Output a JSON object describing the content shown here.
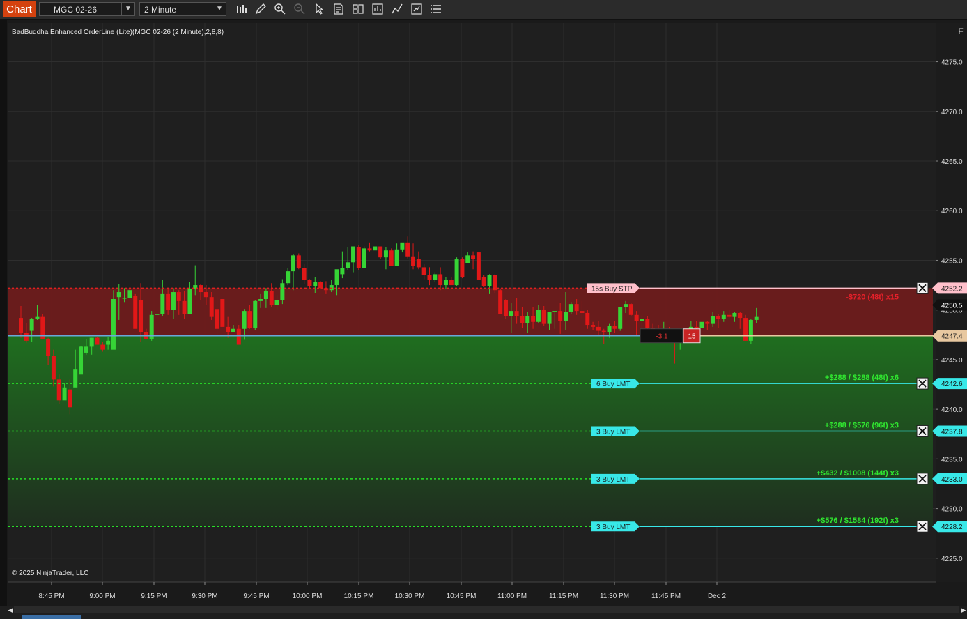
{
  "toolbar": {
    "chart_tab": "Chart",
    "instrument": "MGC 02-26",
    "interval": "2 Minute",
    "tools": [
      "bars-icon",
      "pencil-icon",
      "zoom-in-icon",
      "zoom-out-icon",
      "cursor-icon",
      "data-box-icon",
      "properties-icon",
      "indicators-icon",
      "strategies-icon",
      "snapshot-icon",
      "menu-icon"
    ]
  },
  "indicator_label": "BadBuddha Enhanced OrderLine (Lite)(MGC 02-26 (2 Minute),2,8,8)",
  "copyright": "© 2025 NinjaTrader, LLC",
  "f_button": "F",
  "colors": {
    "background": "#1e1e1e",
    "up_candle": "#36d436",
    "down_candle": "#e01818",
    "stop_zone": "#6e1c1c",
    "profit_zone": "#1f6b1f",
    "cyan": "#38e8e8",
    "pink": "#ffc0cb",
    "entry_line": "#69a8d8"
  },
  "chart_data": {
    "type": "candlestick",
    "instrument": "MGC 02-26",
    "interval": "2 Minute",
    "ylim": [
      4222.6,
      4278.9
    ],
    "y_ticks": [
      "4225.0",
      "4230.0",
      "4235.0",
      "4240.0",
      "4245.0",
      "4250.0",
      "4255.0",
      "4260.0",
      "4265.0",
      "4270.0",
      "4275.0"
    ],
    "x_ticks": [
      "8:45 PM",
      "9:00 PM",
      "9:15 PM",
      "9:30 PM",
      "9:45 PM",
      "10:00 PM",
      "10:15 PM",
      "10:30 PM",
      "10:45 PM",
      "11:00 PM",
      "11:15 PM",
      "11:30 PM",
      "11:45 PM",
      "Dec 2"
    ],
    "bar_count": 136,
    "candles": [
      [
        4249.2,
        4250.4,
        4247.2,
        4247.7
      ],
      [
        4247.7,
        4248.7,
        4246.7,
        4246.9
      ],
      [
        4247.9,
        4249.2,
        4246.8,
        4249.1
      ],
      [
        4249.1,
        4250.5,
        4249.0,
        4249.3
      ],
      [
        4249.3,
        4249.6,
        4247.3,
        4247.1
      ],
      [
        4247.1,
        4247.2,
        4244.5,
        4245.4
      ],
      [
        4245.4,
        4246.0,
        4242.3,
        4243.0
      ],
      [
        4243.0,
        4243.5,
        4240.5,
        4240.9
      ],
      [
        4240.9,
        4242.6,
        4241.8,
        4242.2
      ],
      [
        4242.0,
        4243.0,
        4239.5,
        4240.2
      ],
      [
        4242.2,
        4246.0,
        4243.4,
        4244.0
      ],
      [
        4243.5,
        4246.4,
        4243.6,
        4246.3
      ],
      [
        4245.7,
        4247.1,
        4245.5,
        4246.3
      ],
      [
        4246.3,
        4247.2,
        4245.5,
        4247.2
      ],
      [
        4247.2,
        4247.3,
        4246.5,
        4246.5
      ],
      [
        4246.5,
        4246.8,
        4245.8,
        4246.0
      ],
      [
        4246.5,
        4247.3,
        4246.0,
        4246.9
      ],
      [
        4246.0,
        4252.0,
        4247.0,
        4251.1
      ],
      [
        4251.3,
        4252.6,
        4249.0,
        4251.8
      ],
      [
        4251.2,
        4252.2,
        4250.8,
        4251.2
      ],
      [
        4251.2,
        4252.2,
        4251.5,
        4252.0
      ],
      [
        4251.4,
        4251.6,
        4249.2,
        4248.1
      ],
      [
        4251.0,
        4252.7,
        4246.8,
        4247.8
      ],
      [
        4247.8,
        4248.1,
        4247.2,
        4247.1
      ],
      [
        4247.1,
        4249.9,
        4246.9,
        4249.5
      ],
      [
        4249.5,
        4250.1,
        4248.6,
        4249.6
      ],
      [
        4249.6,
        4253.0,
        4249.4,
        4251.6
      ],
      [
        4251.6,
        4252.2,
        4249.5,
        4250.0
      ],
      [
        4250.0,
        4252.2,
        4249.1,
        4251.8
      ],
      [
        4251.8,
        4252.0,
        4249.5,
        4250.9
      ],
      [
        4250.9,
        4251.9,
        4249.1,
        4249.6
      ],
      [
        4249.6,
        4252.8,
        4250.8,
        4252.1
      ],
      [
        4252.1,
        4254.5,
        4251.5,
        4252.5
      ],
      [
        4252.5,
        4252.6,
        4251.0,
        4251.8
      ],
      [
        4251.8,
        4252.5,
        4250.5,
        4251.3
      ],
      [
        4251.3,
        4251.8,
        4249.0,
        4249.3
      ],
      [
        4250.1,
        4251.4,
        4247.3,
        4248.1
      ],
      [
        4251.1,
        4251.1,
        4248.4,
        4248.3
      ],
      [
        4248.3,
        4249.3,
        4247.2,
        4247.8
      ],
      [
        4247.8,
        4248.5,
        4247.8,
        4248.1
      ],
      [
        4248.1,
        4248.5,
        4246.8,
        4246.5
      ],
      [
        4248.1,
        4250.1,
        4247.0,
        4249.9
      ],
      [
        4249.9,
        4250.5,
        4248.1,
        4248.2
      ],
      [
        4248.2,
        4251.0,
        4248.0,
        4250.9
      ],
      [
        4250.9,
        4251.6,
        4250.2,
        4251.1
      ],
      [
        4251.1,
        4252.2,
        4250.2,
        4251.9
      ],
      [
        4251.9,
        4252.7,
        4250.3,
        4250.5
      ],
      [
        4250.5,
        4251.5,
        4250.1,
        4251.0
      ],
      [
        4251.0,
        4253.1,
        4250.6,
        4252.7
      ],
      [
        4252.7,
        4254.2,
        4252.5,
        4253.9
      ],
      [
        4253.9,
        4255.6,
        4252.0,
        4255.5
      ],
      [
        4255.5,
        4255.7,
        4254.1,
        4254.2
      ],
      [
        4254.2,
        4254.6,
        4252.6,
        4253.0
      ],
      [
        4253.0,
        4253.1,
        4252.1,
        4252.4
      ],
      [
        4252.4,
        4253.3,
        4251.7,
        4252.8
      ],
      [
        4252.8,
        4252.9,
        4252.1,
        4252.2
      ],
      [
        4252.2,
        4252.9,
        4251.6,
        4252.0
      ],
      [
        4252.0,
        4253.0,
        4251.8,
        4252.5
      ],
      [
        4252.5,
        4253.0,
        4251.5,
        4254.1
      ],
      [
        4253.6,
        4255.9,
        4253.2,
        4254.2
      ],
      [
        4254.2,
        4256.3,
        4254.0,
        4254.8
      ],
      [
        4254.8,
        4256.3,
        4253.8,
        4256.4
      ],
      [
        4256.3,
        4256.5,
        4254.0,
        4254.2
      ],
      [
        4254.2,
        4256.4,
        4254.2,
        4256.2
      ],
      [
        4256.2,
        4256.8,
        4255.9,
        4256.0
      ],
      [
        4256.0,
        4256.3,
        4256.2,
        4256.4
      ],
      [
        4256.4,
        4256.4,
        4255.1,
        4255.3
      ],
      [
        4255.3,
        4256.3,
        4254.1,
        4256.0
      ],
      [
        4256.0,
        4256.2,
        4254.4,
        4254.4
      ],
      [
        4254.4,
        4256.7,
        4255.3,
        4256.1
      ],
      [
        4256.1,
        4256.4,
        4255.8,
        4256.8
      ],
      [
        4256.8,
        4257.4,
        4255.2,
        4255.4
      ],
      [
        4255.4,
        4256.7,
        4254.1,
        4254.4
      ],
      [
        4255.1,
        4255.9,
        4254.1,
        4254.3
      ],
      [
        4254.3,
        4254.6,
        4253.1,
        4253.5
      ],
      [
        4253.5,
        4254.3,
        4252.5,
        4253.0
      ],
      [
        4253.0,
        4253.8,
        4252.8,
        4253.6
      ],
      [
        4253.6,
        4254.3,
        4252.0,
        4252.5
      ],
      [
        4252.5,
        4253.3,
        4252.1,
        4253.0
      ],
      [
        4253.0,
        4253.3,
        4252.5,
        4252.5
      ],
      [
        4252.5,
        4255.3,
        4252.4,
        4255.1
      ],
      [
        4255.1,
        4255.3,
        4253.2,
        4253.3
      ],
      [
        4254.7,
        4255.8,
        4255.0,
        4255.5
      ],
      [
        4255.5,
        4255.9,
        4254.1,
        4255.1
      ],
      [
        4255.8,
        4255.3,
        4253.8,
        4253.0
      ],
      [
        4253.3,
        4253.5,
        4252.3,
        4252.4
      ],
      [
        4252.4,
        4253.6,
        4251.6,
        4253.5
      ],
      [
        4253.5,
        4253.6,
        4251.7,
        4252.0
      ],
      [
        4252.0,
        4252.1,
        4249.8,
        4249.6
      ],
      [
        4251.0,
        4251.1,
        4249.1,
        4249.4
      ],
      [
        4249.4,
        4250.7,
        4247.7,
        4249.9
      ],
      [
        4249.9,
        4251.2,
        4248.6,
        4249.4
      ],
      [
        4249.4,
        4250.3,
        4248.2,
        4248.7
      ],
      [
        4248.7,
        4249.8,
        4247.7,
        4249.4
      ],
      [
        4249.4,
        4250.3,
        4248.1,
        4248.8
      ],
      [
        4248.8,
        4250.5,
        4248.7,
        4250.0
      ],
      [
        4250.0,
        4250.4,
        4248.4,
        4248.6
      ],
      [
        4248.6,
        4249.8,
        4248.0,
        4249.8
      ],
      [
        4249.8,
        4249.8,
        4248.1,
        4249.9
      ],
      [
        4249.9,
        4250.7,
        4247.6,
        4248.9
      ],
      [
        4248.9,
        4251.8,
        4248.0,
        4249.8
      ],
      [
        4249.8,
        4250.8,
        4249.6,
        4250.6
      ],
      [
        4250.6,
        4251.1,
        4249.5,
        4249.9
      ],
      [
        4249.9,
        4250.9,
        4249.1,
        4249.7
      ],
      [
        4249.7,
        4250.0,
        4248.1,
        4248.5
      ],
      [
        4248.5,
        4248.8,
        4248.0,
        4248.3
      ],
      [
        4248.3,
        4248.9,
        4247.4,
        4247.9
      ],
      [
        4247.9,
        4248.1,
        4246.6,
        4247.8
      ],
      [
        4247.8,
        4248.6,
        4247.2,
        4248.4
      ],
      [
        4248.4,
        4248.9,
        4247.7,
        4248.1
      ],
      [
        4248.1,
        4250.2,
        4247.9,
        4250.3
      ],
      [
        4250.3,
        4250.9,
        4249.7,
        4250.6
      ],
      [
        4250.6,
        4250.7,
        4249.4,
        4249.5
      ],
      [
        4249.5,
        4249.9,
        4247.5,
        4248.9
      ],
      [
        4248.9,
        4249.5,
        4247.9,
        4249.1
      ],
      [
        4249.1,
        4249.4,
        4247.8,
        4248.2
      ],
      [
        4248.2,
        4248.6,
        4247.5,
        4248.0
      ],
      [
        4248.0,
        4248.5,
        4247.6,
        4247.7
      ],
      [
        4247.7,
        4248.8,
        4247.4,
        4247.8
      ],
      [
        4247.8,
        4248.3,
        4247.2,
        4247.3
      ],
      [
        4247.3,
        4247.5,
        4244.6,
        4246.8
      ],
      [
        4246.8,
        4247.7,
        4246.0,
        4247.4
      ],
      [
        4247.4,
        4248.1,
        4246.9,
        4247.8
      ],
      [
        4247.8,
        4248.9,
        4247.1,
        4248.3
      ],
      [
        4248.3,
        4248.9,
        4247.8,
        4248.2
      ],
      [
        4248.2,
        4249.0,
        4248.1,
        4248.8
      ],
      [
        4248.8,
        4248.9,
        4248.0,
        4248.6
      ],
      [
        4248.6,
        4249.8,
        4248.3,
        4249.4
      ],
      [
        4249.4,
        4249.6,
        4248.2,
        4249.1
      ],
      [
        4249.1,
        4249.9,
        4248.8,
        4249.5
      ],
      [
        4249.5,
        4250.0,
        4249.2,
        4249.3
      ],
      [
        4249.3,
        4249.8,
        4248.8,
        4249.7
      ],
      [
        4249.7,
        4249.8,
        4248.1,
        4249.2
      ],
      [
        4249.2,
        4249.5,
        4246.9,
        4246.9
      ],
      [
        4246.9,
        4249.1,
        4246.6,
        4249.0
      ],
      [
        4249.0,
        4250.2,
        4248.7,
        4249.3
      ]
    ]
  },
  "price_axis": {
    "stop_price": "4252.2",
    "last_price": "4250.5",
    "entry_price": "4247.4",
    "target_prices": [
      "4242.6",
      "4237.8",
      "4233.0",
      "4228.2"
    ]
  },
  "orders": {
    "stop": {
      "label": "15s  Buy STP",
      "price": 4252.2,
      "pnl": "-$720 (48t) x15"
    },
    "entry": {
      "price": 4247.4,
      "pnl_box": "-3.1",
      "qty_box": "15"
    },
    "targets": [
      {
        "label": "6  Buy LMT",
        "price": 4242.6,
        "pnl": "+$288 / $288 (48t) x6"
      },
      {
        "label": "3  Buy LMT",
        "price": 4237.8,
        "pnl": "+$288 / $576 (96t) x3"
      },
      {
        "label": "3  Buy LMT",
        "price": 4233.0,
        "pnl": "+$432 / $1008 (144t) x3"
      },
      {
        "label": "3  Buy LMT",
        "price": 4228.2,
        "pnl": "+$576 / $1584 (192t) x3"
      }
    ]
  }
}
